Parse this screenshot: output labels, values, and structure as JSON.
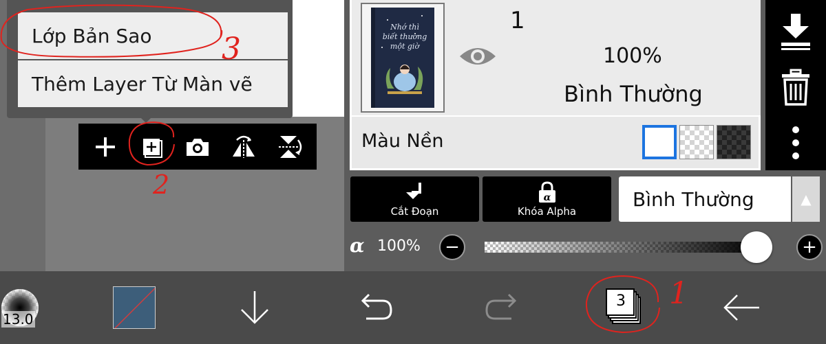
{
  "popup_menu": {
    "items": [
      {
        "label": "Lớp Bản Sao"
      },
      {
        "label": "Thêm Layer Từ Màn vẽ"
      }
    ]
  },
  "layer_toolbar": {
    "add_icon": "plus-icon",
    "duplicate_icon": "duplicate-layer-icon",
    "camera_icon": "camera-icon",
    "flip_h_icon": "flip-horizontal-icon",
    "flip_v_icon": "flip-vertical-icon"
  },
  "layer": {
    "number": "1",
    "opacity": "100%",
    "blend_mode": "Bình Thường",
    "thumb_text": "Nhớ thì\nbiết thương\nmột giờ",
    "visible": true
  },
  "background": {
    "label": "Màu Nền",
    "options": [
      "white",
      "transparent",
      "dark"
    ],
    "selected": "white"
  },
  "options": {
    "clip_label": "Cắt Đoạn",
    "alpha_lock_label": "Khóa Alpha",
    "alpha_lock_icon_text": "α",
    "blend_select_value": "Bình Thường",
    "blend_arrow": "▲"
  },
  "alpha": {
    "symbol": "α",
    "value_label": "100%",
    "level": 1.0,
    "minus": "−",
    "plus": "+"
  },
  "bottom_bar": {
    "brush_size": "13.0",
    "layer_count": "3"
  },
  "annotations": {
    "mark_1": "1",
    "mark_2": "2",
    "mark_3": "3",
    "color": "#e0231e"
  },
  "colors": {
    "accent_blue": "#1c74e0",
    "swatch": "#3d5e7a"
  }
}
